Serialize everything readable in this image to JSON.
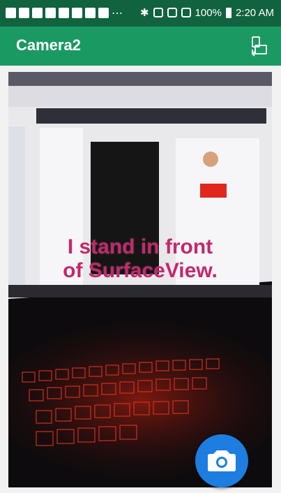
{
  "status_bar": {
    "battery_text": "100%",
    "time": "2:20 AM"
  },
  "app_bar": {
    "title": "Camera2",
    "switch_icon": "switch-camera-icon"
  },
  "preview": {
    "overlay_text_line1": "I stand in front",
    "overlay_text_line2": "of SurfaceView.",
    "overlay_color": "#c4286a"
  },
  "fab": {
    "icon": "camera-icon",
    "color": "#1d7de0"
  },
  "colors": {
    "status_bar": "#11623f",
    "app_bar": "#1b9963"
  }
}
